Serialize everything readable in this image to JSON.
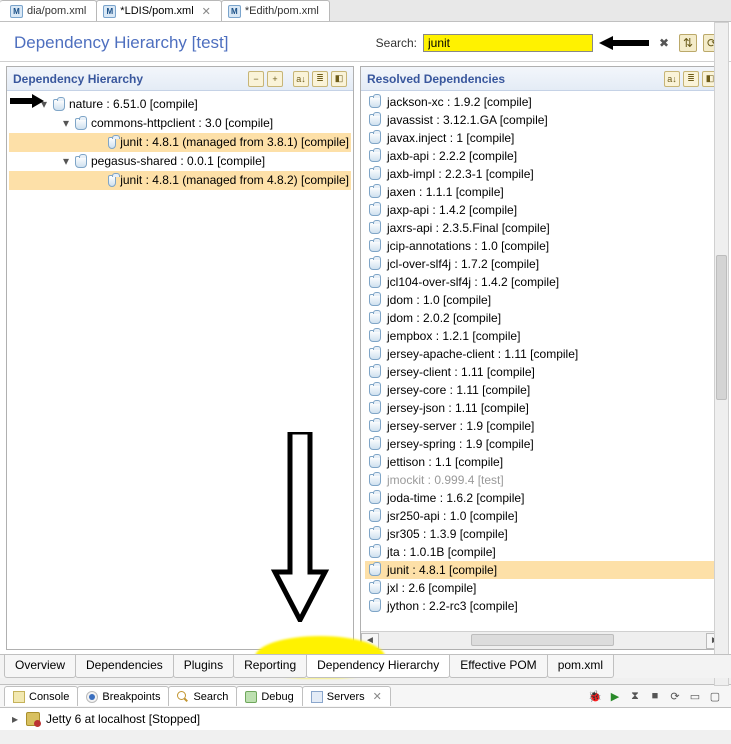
{
  "editorTabs": [
    {
      "label": "dia/pom.xml",
      "dirty": false
    },
    {
      "label": "*LDIS/pom.xml",
      "dirty": true,
      "active": true
    },
    {
      "label": "*Edith/pom.xml",
      "dirty": true
    }
  ],
  "header": {
    "title": "Dependency Hierarchy [test]",
    "searchLabel": "Search:",
    "searchValue": "junit"
  },
  "panels": {
    "left": {
      "title": "Dependency Hierarchy",
      "toolbarIcons": [
        "collapse-all",
        "expand-all",
        "sep",
        "sort",
        "filter",
        "decorate"
      ],
      "tree": [
        {
          "depth": 1,
          "expander": "▾",
          "text": "nature : 6.51.0 [compile]"
        },
        {
          "depth": 2,
          "expander": "▾",
          "text": "commons-httpclient : 3.0 [compile]"
        },
        {
          "depth": 3,
          "expander": "",
          "text": "junit : 4.8.1 (managed from 3.8.1) [compile]",
          "highlight": true
        },
        {
          "depth": 2,
          "expander": "▾",
          "text": "pegasus-shared : 0.0.1 [compile]"
        },
        {
          "depth": 3,
          "expander": "",
          "text": "junit : 4.8.1 (managed from 4.8.2) [compile]",
          "highlight": true
        }
      ]
    },
    "right": {
      "title": "Resolved Dependencies",
      "toolbarIcons": [
        "sort",
        "filter",
        "decorate"
      ],
      "items": [
        {
          "text": "jackson-xc : 1.9.2 [compile]"
        },
        {
          "text": "javassist : 3.12.1.GA [compile]"
        },
        {
          "text": "javax.inject : 1 [compile]"
        },
        {
          "text": "jaxb-api : 2.2.2 [compile]"
        },
        {
          "text": "jaxb-impl : 2.2.3-1 [compile]"
        },
        {
          "text": "jaxen : 1.1.1 [compile]"
        },
        {
          "text": "jaxp-api : 1.4.2 [compile]"
        },
        {
          "text": "jaxrs-api : 2.3.5.Final [compile]"
        },
        {
          "text": "jcip-annotations : 1.0 [compile]"
        },
        {
          "text": "jcl-over-slf4j : 1.7.2 [compile]"
        },
        {
          "text": "jcl104-over-slf4j : 1.4.2 [compile]"
        },
        {
          "text": "jdom : 1.0 [compile]"
        },
        {
          "text": "jdom : 2.0.2 [compile]"
        },
        {
          "text": "jempbox : 1.2.1 [compile]"
        },
        {
          "text": "jersey-apache-client : 1.11 [compile]"
        },
        {
          "text": "jersey-client : 1.11 [compile]"
        },
        {
          "text": "jersey-core : 1.11 [compile]"
        },
        {
          "text": "jersey-json : 1.11 [compile]"
        },
        {
          "text": "jersey-server : 1.9 [compile]"
        },
        {
          "text": "jersey-spring : 1.9 [compile]"
        },
        {
          "text": "jettison : 1.1 [compile]"
        },
        {
          "text": "jmockit : 0.999.4 [test]",
          "dim": true
        },
        {
          "text": "joda-time : 1.6.2 [compile]"
        },
        {
          "text": "jsr250-api : 1.0 [compile]"
        },
        {
          "text": "jsr305 : 1.3.9 [compile]"
        },
        {
          "text": "jta : 1.0.1B [compile]"
        },
        {
          "text": "junit : 4.8.1 [compile]",
          "highlight": true
        },
        {
          "text": "jxl : 2.6 [compile]"
        },
        {
          "text": "jython : 2.2-rc3 [compile]"
        }
      ]
    }
  },
  "bottomTabs": [
    {
      "label": "Overview"
    },
    {
      "label": "Dependencies"
    },
    {
      "label": "Plugins"
    },
    {
      "label": "Reporting"
    },
    {
      "label": "Dependency Hierarchy",
      "active": true
    },
    {
      "label": "Effective POM"
    },
    {
      "label": "pom.xml"
    }
  ],
  "viewTabs": [
    {
      "label": "Console",
      "icon": "console"
    },
    {
      "label": "Breakpoints",
      "icon": "breakpoint"
    },
    {
      "label": "Search",
      "icon": "search"
    },
    {
      "label": "Debug",
      "icon": "debug"
    },
    {
      "label": "Servers",
      "icon": "servers",
      "active": true
    }
  ],
  "serverStatus": "Jetty 6 at localhost  [Stopped]"
}
